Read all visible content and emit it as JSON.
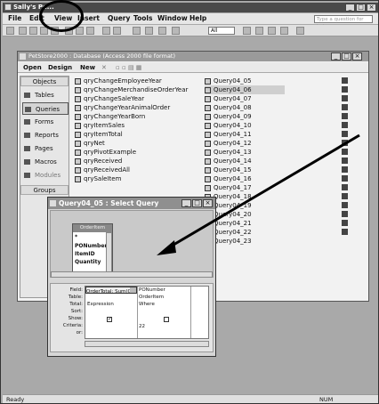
{
  "app": {
    "title": "Sally's Pe...",
    "window_controls": [
      "_",
      "□",
      "×"
    ]
  },
  "menu": {
    "items": [
      "File",
      "Edit",
      "View",
      "Insert",
      "Query",
      "Tools",
      "Window",
      "Help"
    ],
    "help_placeholder": "Type a question for help"
  },
  "toolbar": {
    "all_value": "All"
  },
  "db_window": {
    "title": "PetStore2000 : Database (Access 2000 file format)",
    "toolbar": {
      "open": "Open",
      "design": "Design",
      "new": "New"
    },
    "objects_header": "Objects",
    "objects": [
      "Tables",
      "Queries",
      "Forms",
      "Reports",
      "Pages",
      "Macros",
      "Modules"
    ],
    "groups_header": "Groups",
    "queries_col1": [
      "qryChangeEmployeeYear",
      "qryChangeMerchandiseOrderYear",
      "qryChangeSaleYear",
      "qryChangeYearAnimalOrder",
      "qryChangeYearBorn",
      "qryItemSales",
      "qryItemTotal",
      "qryNet",
      "qryPivotExample",
      "qryReceived",
      "qryReceivedAll",
      "qrySaleItem"
    ],
    "queries_col2": [
      "Query04_05",
      "Query04_06",
      "Query04_07",
      "Query04_08",
      "Query04_09",
      "Query04_10",
      "Query04_11",
      "Query04_12",
      "Query04_13",
      "Query04_14",
      "Query04_15",
      "Query04_16",
      "Query04_17",
      "Query04_18",
      "Query04_19",
      "Query04_20",
      "Query04_21",
      "Query04_22",
      "Query04_23"
    ],
    "selected_query": "Query04_06"
  },
  "query_window": {
    "title": "Query04_05 : Select Query",
    "table": {
      "name": "OrderItem",
      "fields": [
        "*",
        "PONumber",
        "ItemID",
        "Quantity"
      ]
    },
    "grid_labels": [
      "Field:",
      "Table:",
      "Total:",
      "Sort:",
      "Show:",
      "Criteria:",
      "or:"
    ],
    "columns": [
      {
        "field": "OrderTotal: Sum(Or",
        "table": "",
        "total": "Expression",
        "sort": "",
        "show": "checked",
        "criteria": ""
      },
      {
        "field": "PONumber",
        "table": "OrderItem",
        "total": "Where",
        "sort": "",
        "show": "unchecked",
        "criteria": "22"
      }
    ]
  },
  "status": {
    "left": "Ready",
    "right": "NUM"
  }
}
